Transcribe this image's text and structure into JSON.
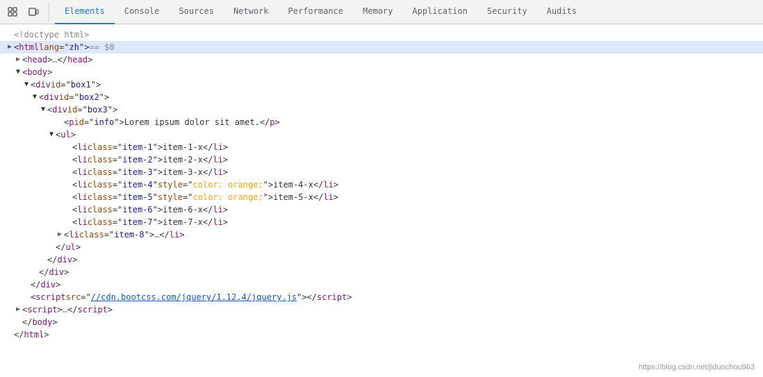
{
  "toolbar": {
    "icons": [
      {
        "name": "cursor-icon",
        "symbol": "⊡"
      },
      {
        "name": "device-icon",
        "symbol": "▭"
      }
    ]
  },
  "tabs": [
    {
      "id": "elements",
      "label": "Elements",
      "active": true
    },
    {
      "id": "console",
      "label": "Console",
      "active": false
    },
    {
      "id": "sources",
      "label": "Sources",
      "active": false
    },
    {
      "id": "network",
      "label": "Network",
      "active": false
    },
    {
      "id": "performance",
      "label": "Performance",
      "active": false
    },
    {
      "id": "memory",
      "label": "Memory",
      "active": false
    },
    {
      "id": "application",
      "label": "Application",
      "active": false
    },
    {
      "id": "security",
      "label": "Security",
      "active": false
    },
    {
      "id": "audits",
      "label": "Audits",
      "active": false
    }
  ],
  "lines": [
    {
      "indent": 0,
      "arrow": "none",
      "content": "doctype"
    },
    {
      "indent": 0,
      "arrow": "collapsed",
      "content": "html_lang",
      "highlighted": true
    },
    {
      "indent": 1,
      "arrow": "collapsed",
      "content": "head"
    },
    {
      "indent": 1,
      "arrow": "open",
      "content": "body"
    },
    {
      "indent": 2,
      "arrow": "open",
      "content": "div_box1"
    },
    {
      "indent": 3,
      "arrow": "open",
      "content": "div_box2"
    },
    {
      "indent": 4,
      "arrow": "open",
      "content": "div_box3"
    },
    {
      "indent": 5,
      "arrow": "none",
      "content": "p_info"
    },
    {
      "indent": 5,
      "arrow": "open",
      "content": "ul"
    },
    {
      "indent": 6,
      "arrow": "none",
      "content": "li_item1"
    },
    {
      "indent": 6,
      "arrow": "none",
      "content": "li_item2"
    },
    {
      "indent": 6,
      "arrow": "none",
      "content": "li_item3"
    },
    {
      "indent": 6,
      "arrow": "none",
      "content": "li_item4"
    },
    {
      "indent": 6,
      "arrow": "none",
      "content": "li_item5"
    },
    {
      "indent": 6,
      "arrow": "none",
      "content": "li_item6"
    },
    {
      "indent": 6,
      "arrow": "none",
      "content": "li_item7"
    },
    {
      "indent": 6,
      "arrow": "collapsed",
      "content": "li_item8"
    },
    {
      "indent": 5,
      "arrow": "none",
      "content": "close_ul"
    },
    {
      "indent": 4,
      "arrow": "none",
      "content": "close_div3"
    },
    {
      "indent": 3,
      "arrow": "none",
      "content": "close_div2"
    },
    {
      "indent": 2,
      "arrow": "none",
      "content": "close_div1"
    },
    {
      "indent": 2,
      "arrow": "none",
      "content": "script_cdn"
    },
    {
      "indent": 2,
      "arrow": "collapsed",
      "content": "script2"
    },
    {
      "indent": 1,
      "arrow": "none",
      "content": "close_body"
    },
    {
      "indent": 0,
      "arrow": "none",
      "content": "close_html"
    }
  ],
  "watermark": "https://blog.csdn.net/jiduochou963"
}
